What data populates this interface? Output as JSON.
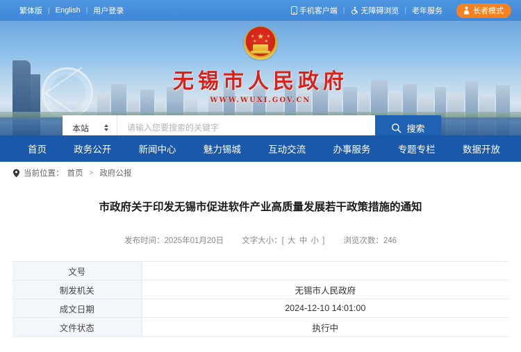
{
  "topbar": {
    "left_links": [
      {
        "label": "繁体版",
        "name": "traditional-chinese-link"
      },
      {
        "label": "English",
        "name": "english-link"
      },
      {
        "label": "用户登录",
        "name": "user-login-link"
      }
    ],
    "separator": "|",
    "right_links": [
      {
        "label": "手机客户端",
        "icon": "mobile-phone-icon",
        "name": "mobile-app-link"
      },
      {
        "label": "无障碍浏览",
        "icon": "wheelchair-accessibility-icon",
        "name": "accessibility-link"
      },
      {
        "label": "老年服务",
        "icon": "",
        "name": "elderly-service-link"
      }
    ],
    "elder_button": {
      "label": "长者模式",
      "icon": "person-icon",
      "color": "#f5821f"
    }
  },
  "banner": {
    "emblem": "national-emblem-icon",
    "site_title": "无锡市人民政府",
    "site_url": "WWW.WUXI.GOV.CN"
  },
  "search": {
    "scope_value": "本站",
    "placeholder": "请输入您要搜索的关键字",
    "button_label": "搜索",
    "button_icon": "search-icon",
    "button_color": "#1f62b4",
    "input_value": ""
  },
  "nav": {
    "items": [
      {
        "label": "首页",
        "name": "nav-item-home"
      },
      {
        "label": "政务公开",
        "name": "nav-item-government-affairs"
      },
      {
        "label": "新闻中心",
        "name": "nav-item-news"
      },
      {
        "label": "魅力锡城",
        "name": "nav-item-charming-wuxi"
      },
      {
        "label": "互动交流",
        "name": "nav-item-interaction"
      },
      {
        "label": "办事服务",
        "name": "nav-item-services"
      },
      {
        "label": "专题专栏",
        "name": "nav-item-special-topics"
      },
      {
        "label": "数据开放",
        "name": "nav-item-open-data"
      }
    ],
    "background": "#1a58ab"
  },
  "breadcrumb": {
    "icon": "location-pin-icon",
    "label": "当前位置：",
    "items": [
      "首页",
      "政府公报"
    ],
    "separator": ">"
  },
  "article": {
    "title": "市政府关于印发无锡市促进软件产业高质量发展若干政策措施的通知",
    "meta": {
      "publish_label": "发布时间：",
      "publish_date": "2025年01月20日",
      "font_size_label": "文字大小：",
      "font_size_options": "[ 大 中 小 ]",
      "views_label": "浏览次数：",
      "views_count": "246"
    },
    "table": {
      "rows": [
        {
          "key": "文号",
          "value": ""
        },
        {
          "key": "制发机关",
          "value": "无锡市人民政府"
        },
        {
          "key": "成文日期",
          "value": "2024-12-10 14:01:00"
        },
        {
          "key": "文件状态",
          "value": "执行中"
        }
      ]
    }
  }
}
